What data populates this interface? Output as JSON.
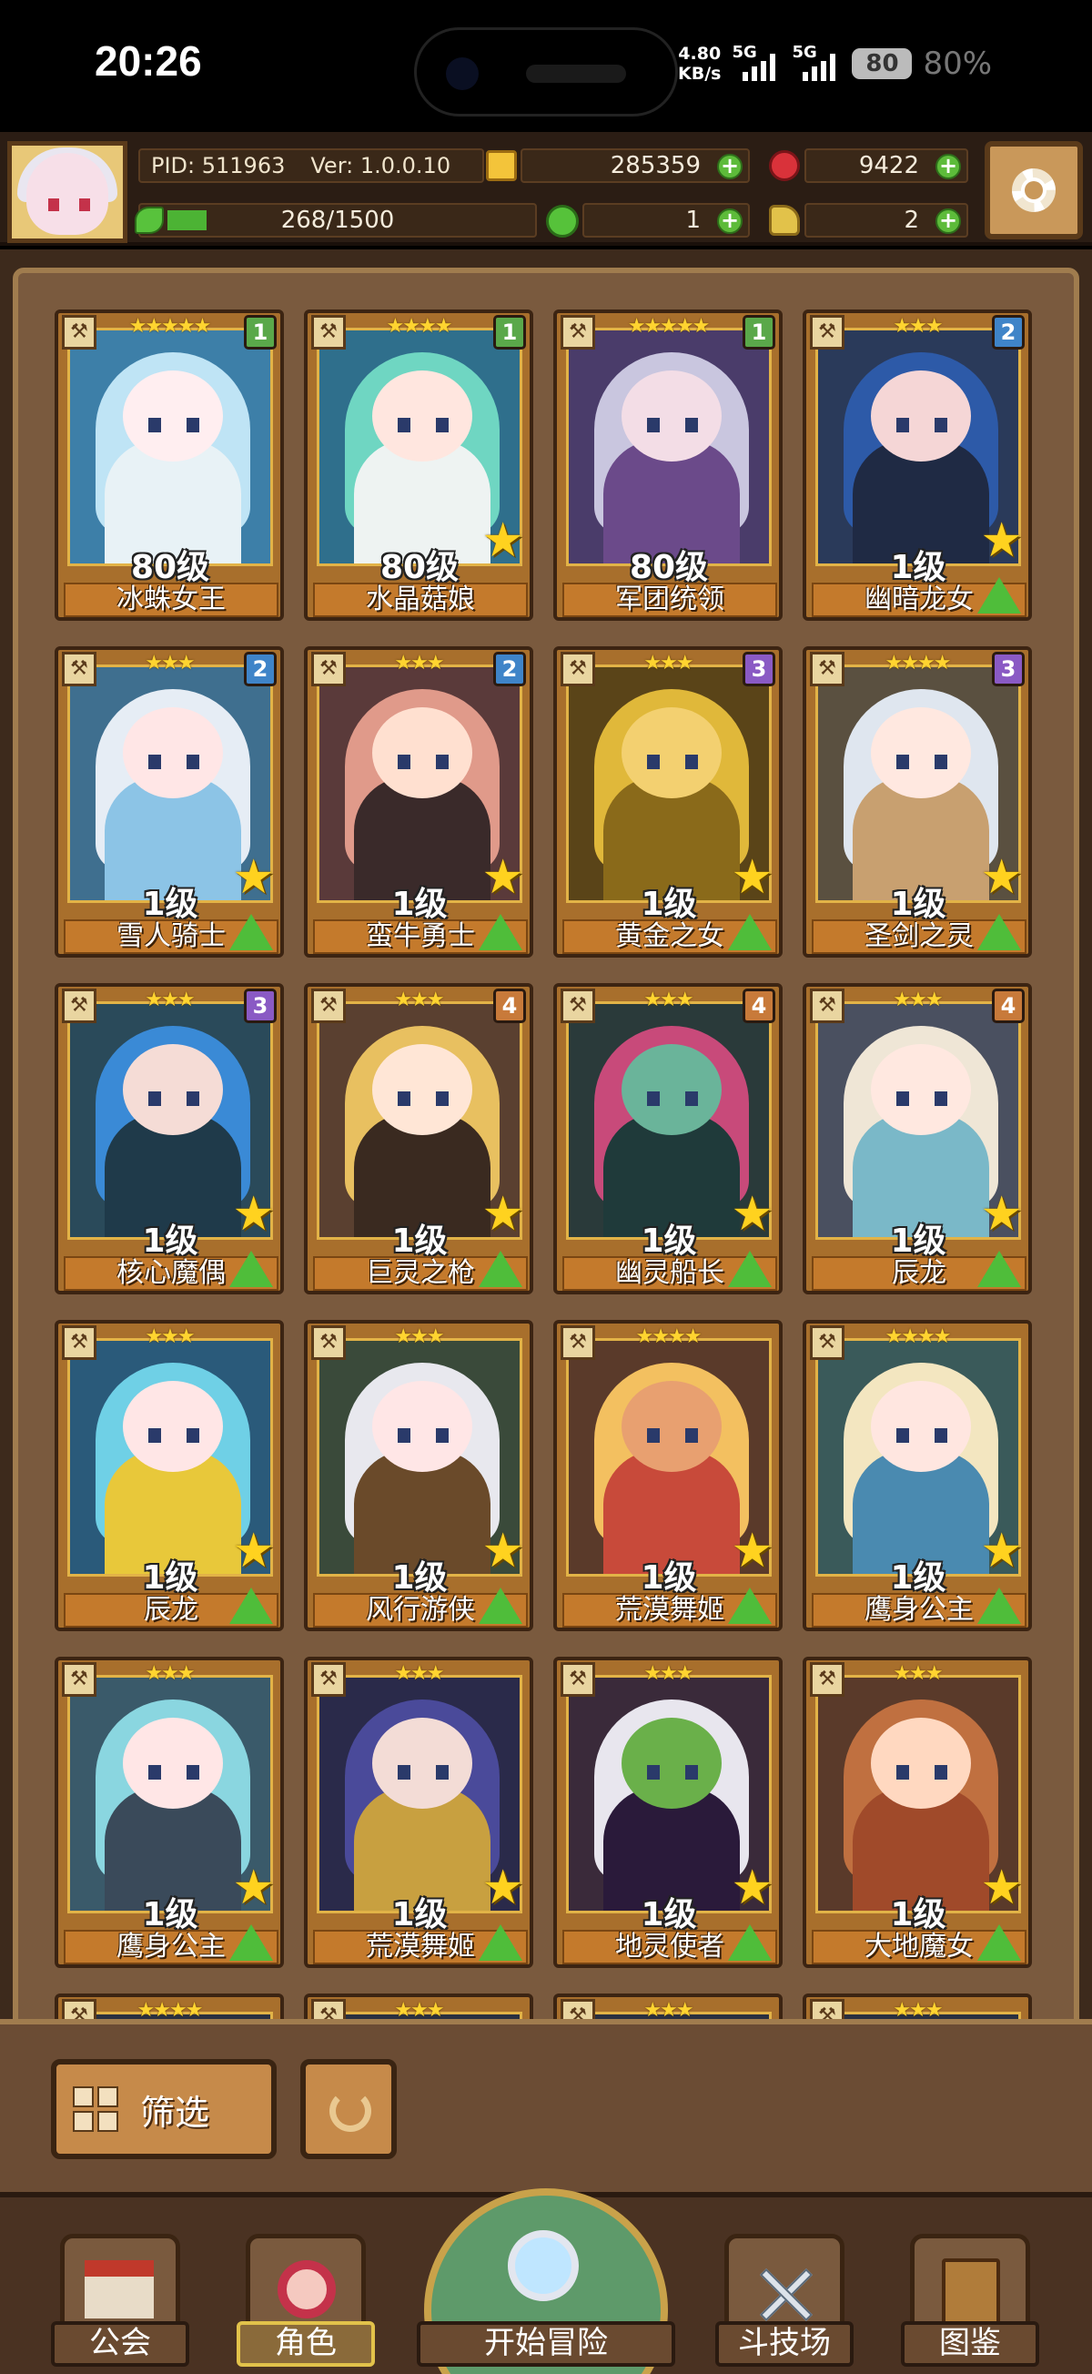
{
  "status_bar": {
    "time": "20:26",
    "speed_top": "4.80",
    "speed_bottom": "KB/s",
    "net1": "5G",
    "net2": "5G",
    "battery": "80",
    "battery_pct": "80%"
  },
  "hud": {
    "pid": "PID: 511963",
    "version": "Ver: 1.0.0.10",
    "coins": "285359",
    "gems": "9422",
    "energy": "268/1500",
    "energy_fraction": 0.179,
    "clover": "1",
    "boots": "2",
    "colors": {
      "plus": "#5dbb3a",
      "coin": "#f3c43a",
      "gem": "#d9323a"
    }
  },
  "cards": [
    {
      "name": "冰蛛女王",
      "level": "80级",
      "tier": "1",
      "tier_color": "#5aa84a",
      "stars": "★★★★★",
      "palette": [
        "#3d7fa8",
        "#bfe4f5",
        "#ffeef0",
        "#e8f2f6"
      ],
      "show_star": false,
      "show_up": false
    },
    {
      "name": "水晶菇娘",
      "level": "80级",
      "tier": "1",
      "tier_color": "#5aa84a",
      "stars": "★★★★",
      "palette": [
        "#2f6f8c",
        "#6fd6c2",
        "#ffe6df",
        "#eef3f2"
      ],
      "show_star": true,
      "show_up": false
    },
    {
      "name": "军团统领",
      "level": "80级",
      "tier": "1",
      "tier_color": "#5aa84a",
      "stars": "★★★★★",
      "palette": [
        "#4a3c6a",
        "#c9c6df",
        "#f3dde6",
        "#6b4a8a"
      ],
      "show_star": false,
      "show_up": false
    },
    {
      "name": "幽暗龙女",
      "level": "1级",
      "tier": "2",
      "tier_color": "#3f84c8",
      "stars": "★★★",
      "palette": [
        "#2a3a5a",
        "#2d5aa8",
        "#f5d6d6",
        "#1f2a44"
      ],
      "show_star": true,
      "show_up": true
    },
    {
      "name": "雪人骑士",
      "level": "1级",
      "tier": "2",
      "tier_color": "#3f84c8",
      "stars": "★★★",
      "palette": [
        "#3f6f8f",
        "#e6edf5",
        "#ffe6e6",
        "#8cc4e6"
      ],
      "show_star": true,
      "show_up": true
    },
    {
      "name": "蛮牛勇士",
      "level": "1级",
      "tier": "2",
      "tier_color": "#3f84c8",
      "stars": "★★★",
      "palette": [
        "#5a3a3a",
        "#e09a8a",
        "#ffe0d0",
        "#3a2a2a"
      ],
      "show_star": true,
      "show_up": true
    },
    {
      "name": "黄金之女",
      "level": "1级",
      "tier": "3",
      "tier_color": "#8a5ac4",
      "stars": "★★★",
      "palette": [
        "#5a4418",
        "#e0b83a",
        "#f3d070",
        "#8a6a1a"
      ],
      "show_star": true,
      "show_up": true
    },
    {
      "name": "圣剑之灵",
      "level": "1级",
      "tier": "3",
      "tier_color": "#8a5ac4",
      "stars": "★★★★",
      "palette": [
        "#5a5040",
        "#dfe6ef",
        "#ffe8e0",
        "#c8a070"
      ],
      "show_star": true,
      "show_up": true
    },
    {
      "name": "核心魔偶",
      "level": "1级",
      "tier": "3",
      "tier_color": "#8a5ac4",
      "stars": "★★★",
      "palette": [
        "#2a4a5a",
        "#3a8ad6",
        "#f5dcd6",
        "#1f3a4a"
      ],
      "show_star": true,
      "show_up": true
    },
    {
      "name": "巨灵之枪",
      "level": "1级",
      "tier": "4",
      "tier_color": "#c87a3a",
      "stars": "★★★",
      "palette": [
        "#5a4030",
        "#e8c060",
        "#ffe6d6",
        "#3a2a20"
      ],
      "show_star": true,
      "show_up": true
    },
    {
      "name": "幽灵船长",
      "level": "1级",
      "tier": "4",
      "tier_color": "#c87a3a",
      "stars": "★★★",
      "palette": [
        "#2a3a3a",
        "#c84a7a",
        "#6ab49a",
        "#1f3a3a"
      ],
      "show_star": true,
      "show_up": true
    },
    {
      "name": "辰龙",
      "level": "1级",
      "tier": "4",
      "tier_color": "#c87a3a",
      "stars": "★★★",
      "palette": [
        "#4a5060",
        "#efe6d6",
        "#ffe8e0",
        "#7ab8c8"
      ],
      "show_star": true,
      "show_up": true
    },
    {
      "name": "辰龙",
      "level": "1级",
      "tier": "",
      "tier_color": "",
      "stars": "★★★",
      "palette": [
        "#2a5a7a",
        "#6fd0e6",
        "#ffe6e6",
        "#e8c83a"
      ],
      "show_star": true,
      "show_up": true
    },
    {
      "name": "风行游侠",
      "level": "1级",
      "tier": "",
      "tier_color": "",
      "stars": "★★★",
      "palette": [
        "#3a4a3a",
        "#e8e8ee",
        "#ffe6e6",
        "#6a4a2a"
      ],
      "show_star": true,
      "show_up": true
    },
    {
      "name": "荒漠舞姬",
      "level": "1级",
      "tier": "",
      "tier_color": "",
      "stars": "★★★★",
      "palette": [
        "#5a3a2a",
        "#f3c060",
        "#e8a070",
        "#c84a3a"
      ],
      "show_star": true,
      "show_up": true
    },
    {
      "name": "鹰身公主",
      "level": "1级",
      "tier": "",
      "tier_color": "",
      "stars": "★★★★",
      "palette": [
        "#3a5a5a",
        "#f3e6c0",
        "#ffe6e0",
        "#4a8ab0"
      ],
      "show_star": true,
      "show_up": true
    },
    {
      "name": "鹰身公主",
      "level": "1级",
      "tier": "",
      "tier_color": "",
      "stars": "★★★",
      "palette": [
        "#3a5a6a",
        "#8ad6e0",
        "#ffe6e6",
        "#3a4a5a"
      ],
      "show_star": true,
      "show_up": true
    },
    {
      "name": "荒漠舞姬",
      "level": "1级",
      "tier": "",
      "tier_color": "",
      "stars": "★★★",
      "palette": [
        "#2a2a4a",
        "#4a4a9a",
        "#f3dcd6",
        "#c8a040"
      ],
      "show_star": true,
      "show_up": true
    },
    {
      "name": "地灵使者",
      "level": "1级",
      "tier": "",
      "tier_color": "",
      "stars": "★★★",
      "palette": [
        "#3a2a3a",
        "#e8e6ee",
        "#6ab04a",
        "#2a1a3a"
      ],
      "show_star": true,
      "show_up": true
    },
    {
      "name": "大地魔女",
      "level": "1级",
      "tier": "",
      "tier_color": "",
      "stars": "★★★",
      "palette": [
        "#5a3a2a",
        "#c07040",
        "#ffd8c0",
        "#a04a2a"
      ],
      "show_star": true,
      "show_up": true
    }
  ],
  "partial_row_stars": [
    "★★★★",
    "★★★",
    "★★★",
    "★★★"
  ],
  "filter": {
    "label": "筛选"
  },
  "nav": {
    "guild": "公会",
    "character": "角色",
    "adventure": "开始冒险",
    "arena": "斗技场",
    "codex": "图鉴"
  }
}
